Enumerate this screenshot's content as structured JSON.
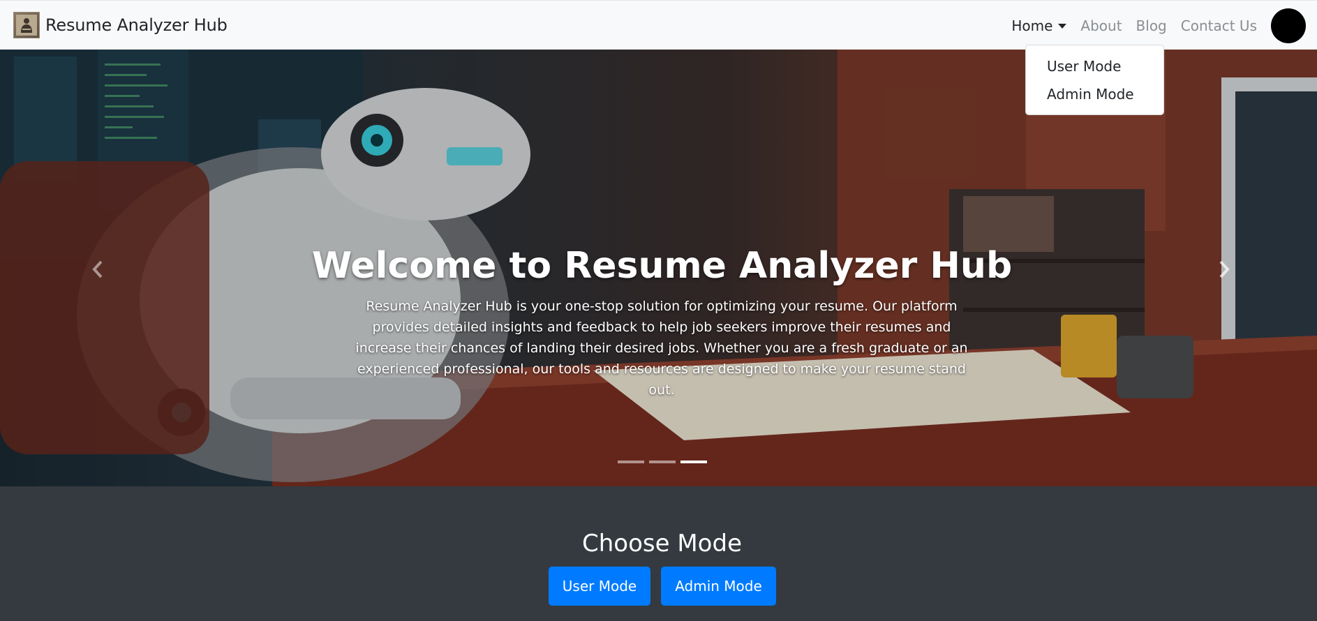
{
  "navbar": {
    "brand": "Resume Analyzer Hub",
    "brand_icon": "logo-icon",
    "links": {
      "home": "Home",
      "about": "About",
      "blog": "Blog",
      "contact": "Contact Us"
    },
    "avatar_icon": "avatar"
  },
  "dropdown": {
    "items": [
      "User Mode",
      "Admin Mode"
    ]
  },
  "hero": {
    "title": "Welcome to Resume Analyzer Hub",
    "description": "Resume Analyzer Hub is your one-stop solution for optimizing your resume. Our platform provides detailed insights and feedback to help job seekers improve their resumes and increase their chances of landing their desired jobs. Whether you are a fresh graduate or an experienced professional, our tools and resources are designed to make your resume stand out.",
    "slides": 3,
    "active_slide": 3
  },
  "mode": {
    "title": "Choose Mode",
    "user_button": "User Mode",
    "admin_button": "Admin Mode"
  },
  "colors": {
    "primary": "#007bff",
    "navbar_bg": "#f8f9fa",
    "section_bg": "#343a40"
  }
}
